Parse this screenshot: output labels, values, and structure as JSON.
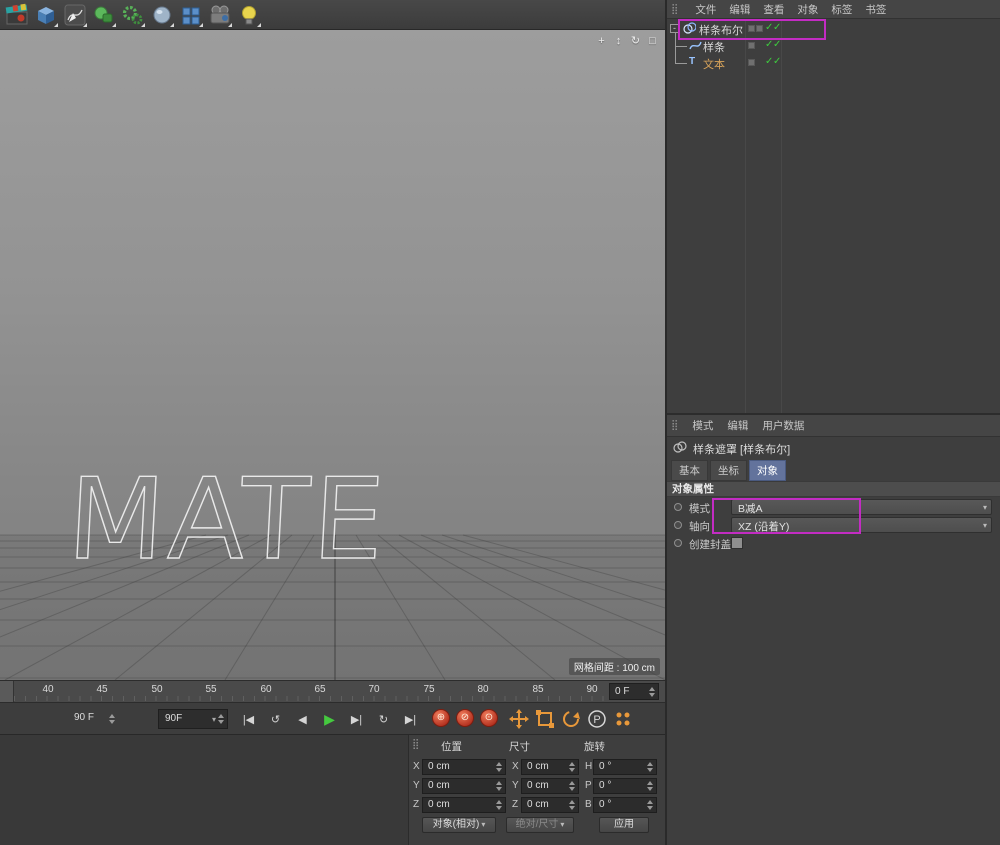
{
  "glyphs": {
    "check": "✓",
    "dropdown": "▾",
    "collapse": "-",
    "handle": "⣿"
  },
  "toolbar": {
    "icons": [
      "clapperboard",
      "cube",
      "spline-pen",
      "primitives",
      "gears",
      "sphere",
      "array",
      "camera",
      "light-bulb"
    ]
  },
  "viewport": {
    "wire_text": "MATE",
    "grid_label": "网格间距 : 100 cm",
    "nav": [
      {
        "name": "pan",
        "glyph": "+"
      },
      {
        "name": "zoom",
        "glyph": "↕"
      },
      {
        "name": "rotate",
        "glyph": "↻"
      },
      {
        "name": "toggle-view",
        "glyph": "□"
      }
    ]
  },
  "object_manager": {
    "menu": [
      "文件",
      "编辑",
      "查看",
      "对象",
      "标签",
      "书签"
    ],
    "items": [
      {
        "label": "样条布尔"
      },
      {
        "label": "样条"
      },
      {
        "label": "文本"
      }
    ]
  },
  "attribute_manager": {
    "menu": [
      "模式",
      "编辑",
      "用户数据"
    ],
    "title": "样条遮罩 [样条布尔]",
    "tabs": [
      "基本",
      "坐标",
      "对象"
    ],
    "active_tab": "对象",
    "section": "对象属性",
    "mode_label": "模式",
    "mode_value": "B减A",
    "axis_label": "轴向",
    "axis_value": "XZ  (沿着Y)",
    "cap_label": "创建封盖"
  },
  "timeline": {
    "ticks": [
      "40",
      "45",
      "50",
      "55",
      "60",
      "65",
      "70",
      "75",
      "80",
      "85",
      "90"
    ],
    "frame_field": "0 F"
  },
  "transport": {
    "end_frame": "90 F",
    "range_value": "90F",
    "buttons": [
      {
        "name": "goto-start",
        "glyph": "|◀"
      },
      {
        "name": "play-backward",
        "glyph": "↺"
      },
      {
        "name": "prev-frame",
        "glyph": "◀"
      },
      {
        "name": "play",
        "glyph": "▶"
      },
      {
        "name": "next-frame",
        "glyph": "▶|"
      },
      {
        "name": "loop",
        "glyph": "↻"
      },
      {
        "name": "goto-end",
        "glyph": "▶|"
      }
    ],
    "record_buttons": [
      {
        "name": "record-keyframe",
        "glyph": "⊕"
      },
      {
        "name": "autokey",
        "glyph": "⊘"
      },
      {
        "name": "keyframe-selection",
        "glyph": "⊙"
      }
    ]
  },
  "coordinates": {
    "headers": [
      "位置",
      "尺寸",
      "旋转"
    ],
    "pos_labels": [
      "X",
      "Y",
      "Z"
    ],
    "size_labels": [
      "X",
      "Y",
      "Z"
    ],
    "rot_labels": [
      "H",
      "P",
      "B"
    ],
    "position": {
      "x": "0 cm",
      "y": "0 cm",
      "z": "0 cm"
    },
    "size": {
      "x": "0 cm",
      "y": "0 cm",
      "z": "0 cm"
    },
    "rotation": {
      "h": "0 °",
      "p": "0 °",
      "b": "0 °"
    },
    "mode_button": "对象(相对)",
    "abs_button": "绝对/尺寸",
    "apply_button": "应用"
  }
}
